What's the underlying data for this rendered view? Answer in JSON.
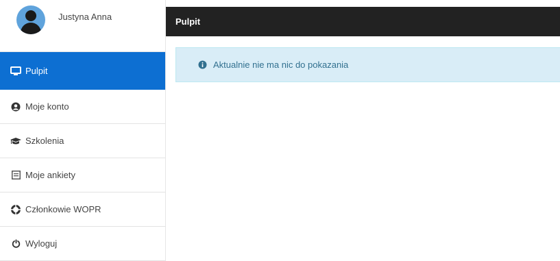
{
  "user": {
    "name": "Justyna Anna"
  },
  "header": {
    "title": "Pulpit"
  },
  "sidebar": {
    "items": [
      {
        "label": "Pulpit",
        "icon": "monitor-icon",
        "active": true
      },
      {
        "label": "Moje konto",
        "icon": "user-circle-icon"
      },
      {
        "label": "Szkolenia",
        "icon": "graduation-cap-icon"
      },
      {
        "label": "Moje ankiety",
        "icon": "survey-icon"
      },
      {
        "label": "Członkowie WOPR",
        "icon": "life-ring-icon"
      },
      {
        "label": "Wyloguj",
        "icon": "power-icon"
      }
    ]
  },
  "alert": {
    "text": "Aktualnie nie ma nic do pokazania",
    "icon": "info-icon"
  },
  "colors": {
    "accent": "#0d6fd2",
    "topbar": "#222222",
    "alert_bg": "#d9edf7",
    "alert_text": "#31708f"
  }
}
